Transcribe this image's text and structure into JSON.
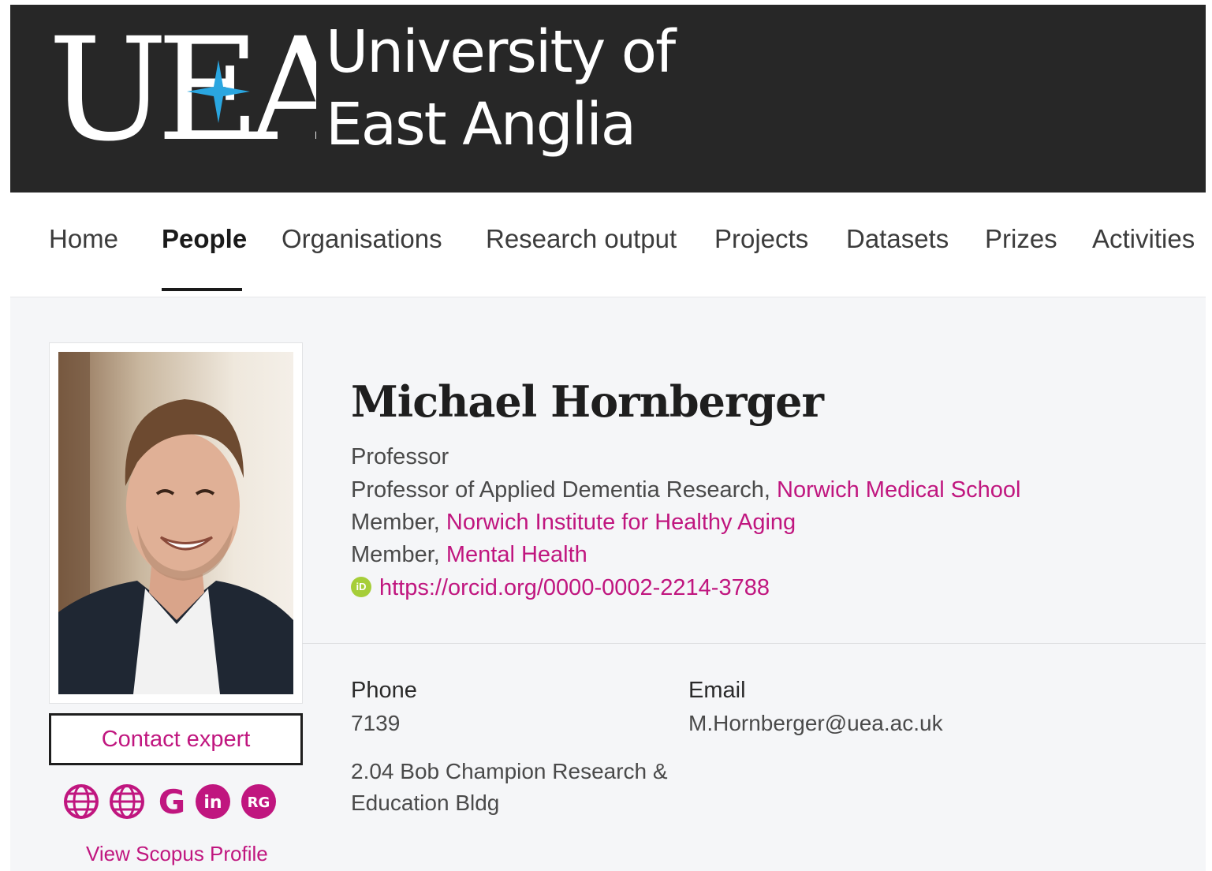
{
  "header": {
    "logo_abbrev": "UEA",
    "logo_line1": "University of",
    "logo_line2": "East Anglia",
    "colors": {
      "background": "#272727",
      "star": "#2aa6e0"
    }
  },
  "nav": {
    "items": [
      {
        "label": "Home",
        "active": false
      },
      {
        "label": "People",
        "active": true
      },
      {
        "label": "Organisations",
        "active": false
      },
      {
        "label": "Research output",
        "active": false
      },
      {
        "label": "Projects",
        "active": false
      },
      {
        "label": "Datasets",
        "active": false
      },
      {
        "label": "Prizes",
        "active": false
      },
      {
        "label": "Activities",
        "active": false
      }
    ]
  },
  "profile": {
    "name": "Michael Hornberger",
    "title": "Professor",
    "roles": [
      {
        "prefix": "Professor of Applied Dementia Research, ",
        "org": "Norwich Medical School"
      },
      {
        "prefix": "Member, ",
        "org": "Norwich Institute for Healthy Aging"
      },
      {
        "prefix": "Member, ",
        "org": "Mental Health"
      }
    ],
    "orcid_icon_text": "iD",
    "orcid_url": "https://orcid.org/0000-0002-2214-3788",
    "contact_button": "Contact expert",
    "social_icons": [
      "globe-icon",
      "globe-icon",
      "google-scholar-icon",
      "linkedin-icon",
      "researchgate-icon"
    ],
    "social_text": {
      "google": "G",
      "linkedin": "in",
      "researchgate": "RG"
    },
    "scopus_link": "View Scopus Profile",
    "phone_label": "Phone",
    "phone_value": "7139",
    "address_line1": "2.04 Bob Champion Research &",
    "address_line2": "Education Bldg",
    "email_label": "Email",
    "email_value": "M.Hornberger@uea.ac.uk"
  },
  "colors": {
    "accent": "#c0167f",
    "orcid": "#a6ce39",
    "content_bg": "#f5f6f8"
  }
}
